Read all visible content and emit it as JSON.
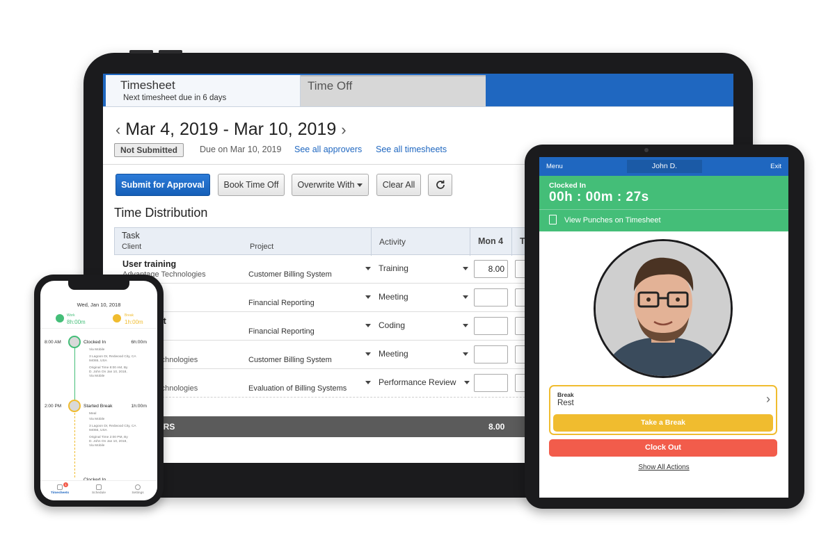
{
  "desktop": {
    "tabs": [
      {
        "label": "Timesheet",
        "sub": "Next timesheet due in 6 days"
      },
      {
        "label": "Time Off"
      }
    ],
    "date_range": "Mar 4, 2019 - Mar 10, 2019",
    "status": "Not Submitted",
    "due": "Due on Mar 10, 2019",
    "link_approvers": "See all approvers",
    "link_timesheets": "See all timesheets",
    "buttons": {
      "submit": "Submit for Approval",
      "book": "Book Time Off",
      "overwrite": "Overwrite With",
      "clear": "Clear All"
    },
    "section_title": "Time Distribution",
    "columns": {
      "task": "Task",
      "client": "Client",
      "project": "Project",
      "activity": "Activity",
      "mon": "Mon 4",
      "tue": "T"
    },
    "rows": [
      {
        "task": "User training",
        "client": "Advantage Technologies",
        "project": "Customer Billing System",
        "activity": "Training",
        "hours": "8.00"
      },
      {
        "task": "nt",
        "client": "C",
        "project": "Financial Reporting",
        "activity": "Meeting",
        "hours": ""
      },
      {
        "task": "ent",
        "client": "C",
        "project": "Financial Reporting",
        "activity": "Coding",
        "hours": ""
      },
      {
        "task": "",
        "client": "Technologies",
        "project": "Customer Billing System",
        "activity": "Meeting",
        "hours": ""
      },
      {
        "task": "",
        "client": "Technologies",
        "project": "Evaluation of Billing Systems",
        "activity": "Performance Review",
        "hours": ""
      }
    ],
    "total_label": "URS",
    "total_value": "8.00"
  },
  "tablet": {
    "menu": "Menu",
    "user": "John D.",
    "exit": "Exit",
    "clock_status": "Clocked In",
    "timer": "00h : 00m : 27s",
    "view_punches": "View Punches on Timesheet",
    "break_key": "Break",
    "break_value": "Rest",
    "take_break": "Take a Break",
    "clock_out": "Clock Out",
    "show_all": "Show All Actions"
  },
  "phone": {
    "date": "Wed, Jan 10, 2018",
    "work_label": "Work",
    "work_value": "8h:00m",
    "break_label": "Break",
    "break_value": "1h:00m",
    "events": [
      {
        "time": "8:00 AM",
        "name": "Clocked In",
        "dur": "6h:00m",
        "meta": [
          "Via Mobile",
          "3 Lagoon Dr, Redwood City, CA",
          "94065, USA",
          "Original Time 8:00 AM, By",
          "D. John On Jan 10, 2018,",
          "Via Mobile"
        ]
      },
      {
        "time": "2:00 PM",
        "name": "Started Break",
        "dur": "1h:00m",
        "meta": [
          "Meal",
          "Via Mobile",
          "3 Lagoon Dr, Redwood City, CA",
          "94065, USA",
          "Original Time 2:00 PM, By",
          "D. John On Jan 10, 2018,",
          "Via Mobile"
        ]
      }
    ],
    "third_event": "Clocked In",
    "badge": "1",
    "nav": [
      "Timesheets",
      "Schedule",
      "Settings"
    ]
  },
  "colors": {
    "brand_blue": "#1f67c0",
    "clocked_green": "#44be78",
    "break_yellow": "#f0bc2f",
    "clockout_red": "#f25c4b"
  }
}
